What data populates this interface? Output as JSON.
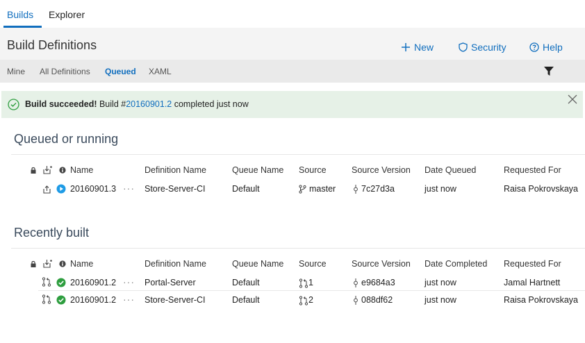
{
  "tabs": [
    {
      "label": "Builds",
      "active": true
    },
    {
      "label": "Explorer",
      "active": false
    }
  ],
  "page": {
    "title": "Build Definitions"
  },
  "actions": {
    "new_label": "New",
    "security_label": "Security",
    "help_label": "Help"
  },
  "subnav": [
    {
      "label": "Mine"
    },
    {
      "label": "All Definitions"
    },
    {
      "label": "Queued",
      "active": true
    },
    {
      "label": "XAML"
    }
  ],
  "banner": {
    "bold": "Build succeeded!",
    "prefix": " Build #",
    "build_link": "20160901.2",
    "suffix": " completed just now"
  },
  "queued": {
    "title": "Queued or running",
    "headers": {
      "name": "Name",
      "definition": "Definition Name",
      "queue": "Queue Name",
      "source": "Source",
      "version": "Source Version",
      "date": "Date Queued",
      "requested": "Requested For"
    },
    "rows": [
      {
        "name": "20160901.3",
        "definition": "Store-Server-CI",
        "queue": "Default",
        "source": "master",
        "version": "7c27d3a",
        "date": "just now",
        "requested": "Raisa Pokrovskaya"
      }
    ]
  },
  "recent": {
    "title": "Recently built",
    "headers": {
      "name": "Name",
      "definition": "Definition Name",
      "queue": "Queue Name",
      "source": "Source",
      "version": "Source Version",
      "date": "Date Completed",
      "requested": "Requested For"
    },
    "rows": [
      {
        "name": "20160901.2",
        "definition": "Portal-Server",
        "queue": "Default",
        "source": "1",
        "version": "e9684a3",
        "date": "just now",
        "requested": "Jamal Hartnett"
      },
      {
        "name": "20160901.2",
        "definition": "Store-Server-CI",
        "queue": "Default",
        "source": "2",
        "version": "088df62",
        "date": "just now",
        "requested": "Raisa Pokrovskaya"
      }
    ]
  },
  "colors": {
    "accent": "#106ebe",
    "success": "#2e9e3f",
    "running": "#1e9be6",
    "banner_bg": "#e6f1e7"
  }
}
